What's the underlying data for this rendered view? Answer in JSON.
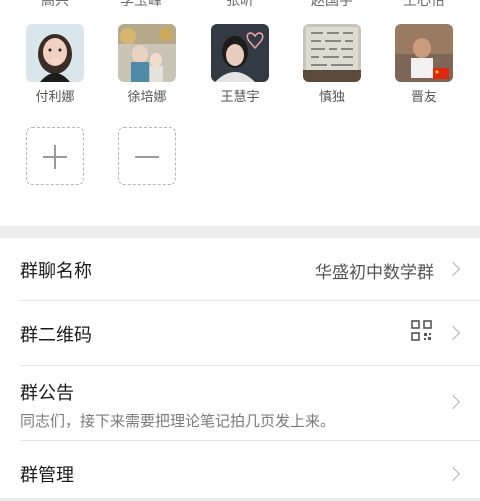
{
  "members": [
    {
      "name": "付利娜",
      "avatar": "girl-photo"
    },
    {
      "name": "徐培娜",
      "avatar": "grandmother-child-photo"
    },
    {
      "name": "王慧宇",
      "avatar": "young-man-heart-photo"
    },
    {
      "name": "慎独",
      "avatar": "calligraphy-photo"
    },
    {
      "name": "晋友",
      "avatar": "man-flag-photo"
    }
  ],
  "top_names": [
    "高兴",
    "李玉峰",
    "张昕",
    "赵国宇",
    "王心怡"
  ],
  "add_member_label": "+",
  "remove_member_label": "−",
  "settings": {
    "group_name": {
      "label": "群聊名称",
      "value": "华盛初中数学群"
    },
    "qr_code": {
      "label": "群二维码"
    },
    "announcement": {
      "label": "群公告",
      "text": "同志们，接下来需要把理论笔记拍几页发上来。"
    },
    "manage": {
      "label": "群管理"
    }
  }
}
